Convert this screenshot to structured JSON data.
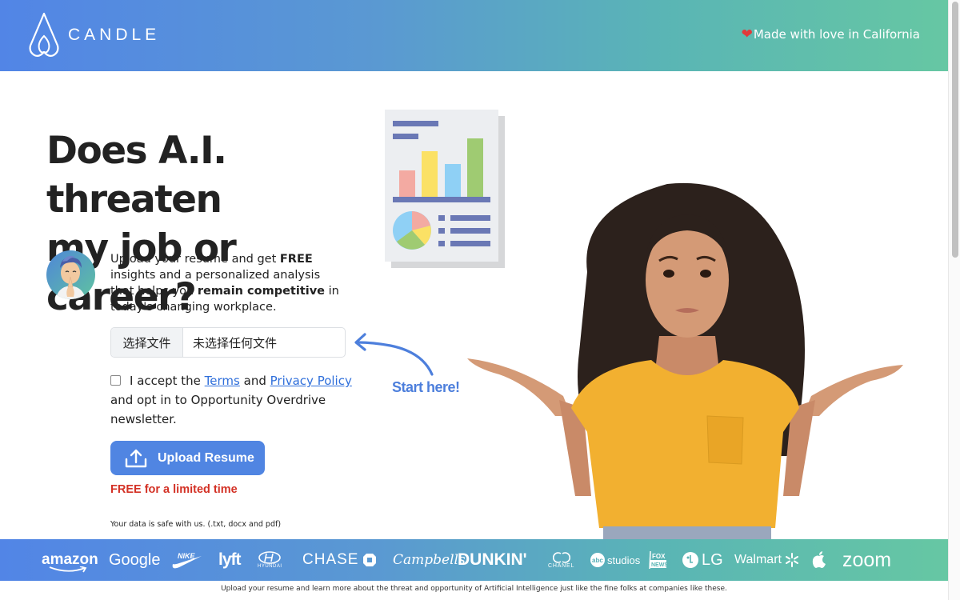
{
  "header": {
    "brand": "CANDLE",
    "tagline_icon": "heart-icon",
    "tagline": "Made with love in California"
  },
  "hero": {
    "headline_line1": "Does A.I. threaten",
    "headline_line2": "my job or career?",
    "intro": {
      "part1": "Upload your resume and get ",
      "bold1": "FREE",
      "part2": " insights and a personalized analysis that helps you ",
      "bold2": "remain competitive",
      "part3": " in today's changing workplace."
    }
  },
  "form": {
    "file_button_label": "选择文件",
    "file_status": "未选择任何文件",
    "consent": {
      "prefix": "I accept the ",
      "terms_link": "Terms",
      "and": " and ",
      "privacy_link": "Privacy Policy",
      "suffix": " and opt in to Opportunity Overdrive newsletter.",
      "checked": false
    },
    "upload_button_label": "Upload Resume",
    "free_note": "FREE for a limited time",
    "safe_note": "Your data is safe with us. (.txt, docx and pdf)"
  },
  "callout": {
    "label": "Start here!"
  },
  "logos": {
    "brands": [
      "amazon",
      "Google",
      "NIKE",
      "lyft",
      "HYUNDAI",
      "CHASE",
      "Campbell's",
      "DUNKIN'",
      "CHANEL",
      "abc studios",
      "FOX NEWS",
      "LG",
      "Walmart",
      "Apple",
      "zoom"
    ]
  },
  "footer": {
    "note": "Upload your resume and learn more about the threat and opportunity of Artificial Intelligence just like the fine folks at companies like these."
  },
  "colors": {
    "accent": "#5085e2",
    "link": "#2f6fdb",
    "free_red": "#d33125",
    "gradient_start": "#5285e6",
    "gradient_end": "#66c7a3"
  }
}
